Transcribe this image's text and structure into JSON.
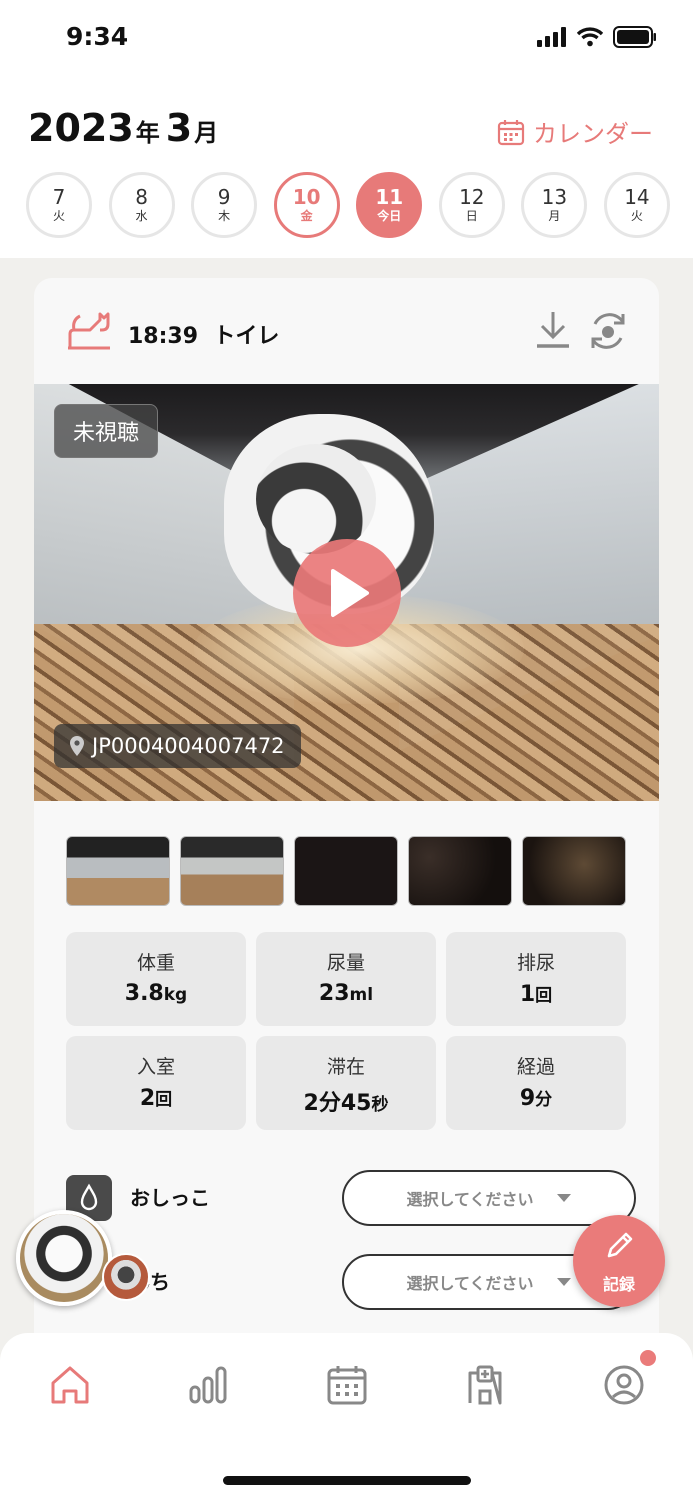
{
  "status_bar": {
    "time": "9:34"
  },
  "header": {
    "year": "2023",
    "year_suffix": "年",
    "month": "3",
    "month_suffix": "月",
    "calendar_label": "カレンダー",
    "accent_color": "#e77a79"
  },
  "days": [
    {
      "num": "7",
      "weekday": "火",
      "state": "normal"
    },
    {
      "num": "8",
      "weekday": "水",
      "state": "normal"
    },
    {
      "num": "9",
      "weekday": "木",
      "state": "normal"
    },
    {
      "num": "10",
      "weekday": "金",
      "state": "selected"
    },
    {
      "num": "11",
      "weekday": "今日",
      "state": "today"
    },
    {
      "num": "12",
      "weekday": "日",
      "state": "normal"
    },
    {
      "num": "13",
      "weekday": "月",
      "state": "normal"
    },
    {
      "num": "14",
      "weekday": "火",
      "state": "normal"
    }
  ],
  "card": {
    "time": "18:39",
    "event": "トイレ",
    "badge": "未視聴",
    "location": "JP0004004007472",
    "thumbnail_count": 5,
    "stats": [
      {
        "label": "体重",
        "value": "3.8",
        "unit": "kg"
      },
      {
        "label": "尿量",
        "value": "23",
        "unit": "ml"
      },
      {
        "label": "排尿",
        "value": "1",
        "unit": "回"
      },
      {
        "label": "入室",
        "value": "2",
        "unit": "回"
      },
      {
        "label": "滞在",
        "value": "2分45",
        "unit": "秒"
      },
      {
        "label": "経過",
        "value": "9",
        "unit": "分"
      }
    ],
    "rows": [
      {
        "label": "おしっこ",
        "placeholder": "選択してください"
      },
      {
        "label": "んち",
        "placeholder": "選択してください"
      }
    ]
  },
  "fab": {
    "label": "記録"
  },
  "tabs": [
    "home-icon",
    "chart-icon",
    "calendar-icon",
    "hospital-icon",
    "profile-icon"
  ]
}
